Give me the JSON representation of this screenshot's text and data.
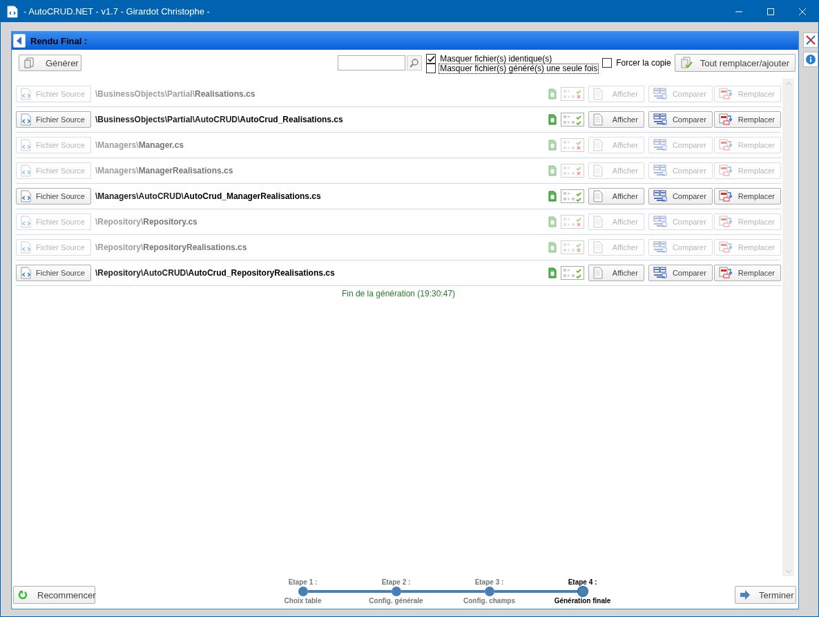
{
  "window": {
    "title": "- AutoCRUD.NET - v1.7 - Girardot Christophe -"
  },
  "panel": {
    "title": "Rendu Final :"
  },
  "toolbar": {
    "generate_button": "Générer",
    "checkboxes": [
      {
        "label": "Masquer fichier(s) identique(s)",
        "checked": true,
        "focused": false
      },
      {
        "label": "Masquer fichier(s) généré(s) une seule fois",
        "checked": false,
        "focused": true
      }
    ],
    "force_copy": {
      "label": "Forcer la copie",
      "checked": false
    },
    "replace_all_button": "Tout remplacer/ajouter"
  },
  "files": [
    {
      "source_button": "Fichier Source",
      "folder": "\\BusinessObjects\\Partial\\",
      "file": "Realisations.cs",
      "enabled": false,
      "show_button": "Afficher",
      "compare_button": "Comparer",
      "replace_button": "Remplacer"
    },
    {
      "source_button": "Fichier Source",
      "folder": "\\BusinessObjects\\Partial\\AutoCRUD\\",
      "file": "AutoCrud_Realisations.cs",
      "enabled": true,
      "show_button": "Afficher",
      "compare_button": "Comparer",
      "replace_button": "Remplacer"
    },
    {
      "source_button": "Fichier Source",
      "folder": "\\Managers\\",
      "file": "Manager.cs",
      "enabled": false,
      "show_button": "Afficher",
      "compare_button": "Comparer",
      "replace_button": "Remplacer"
    },
    {
      "source_button": "Fichier Source",
      "folder": "\\Managers\\",
      "file": "ManagerRealisations.cs",
      "enabled": false,
      "show_button": "Afficher",
      "compare_button": "Comparer",
      "replace_button": "Remplacer"
    },
    {
      "source_button": "Fichier Source",
      "folder": "\\Managers\\AutoCRUD\\",
      "file": "AutoCrud_ManagerRealisations.cs",
      "enabled": true,
      "show_button": "Afficher",
      "compare_button": "Comparer",
      "replace_button": "Remplacer"
    },
    {
      "source_button": "Fichier Source",
      "folder": "\\Repository\\",
      "file": "Repository.cs",
      "enabled": false,
      "show_button": "Afficher",
      "compare_button": "Comparer",
      "replace_button": "Remplacer"
    },
    {
      "source_button": "Fichier Source",
      "folder": "\\Repository\\",
      "file": "RepositoryRealisations.cs",
      "enabled": false,
      "show_button": "Afficher",
      "compare_button": "Comparer",
      "replace_button": "Remplacer"
    },
    {
      "source_button": "Fichier Source",
      "folder": "\\Repository\\AutoCRUD\\",
      "file": "AutoCrud_RepositoryRealisations.cs",
      "enabled": true,
      "show_button": "Afficher",
      "compare_button": "Comparer",
      "replace_button": "Remplacer"
    }
  ],
  "status": "Fin de la génération (19:30:47)",
  "footer": {
    "restart_button": "Recommencer",
    "steps": [
      {
        "title": "Etape 1 :",
        "name": "Choix table",
        "selected": false
      },
      {
        "title": "Etape 2 :",
        "name": "Config. générale",
        "selected": false
      },
      {
        "title": "Etape 3 :",
        "name": "Config. champs",
        "selected": false
      },
      {
        "title": "Etape 4 :",
        "name": "Génération finale",
        "selected": true
      }
    ],
    "finish_button": "Terminer"
  }
}
